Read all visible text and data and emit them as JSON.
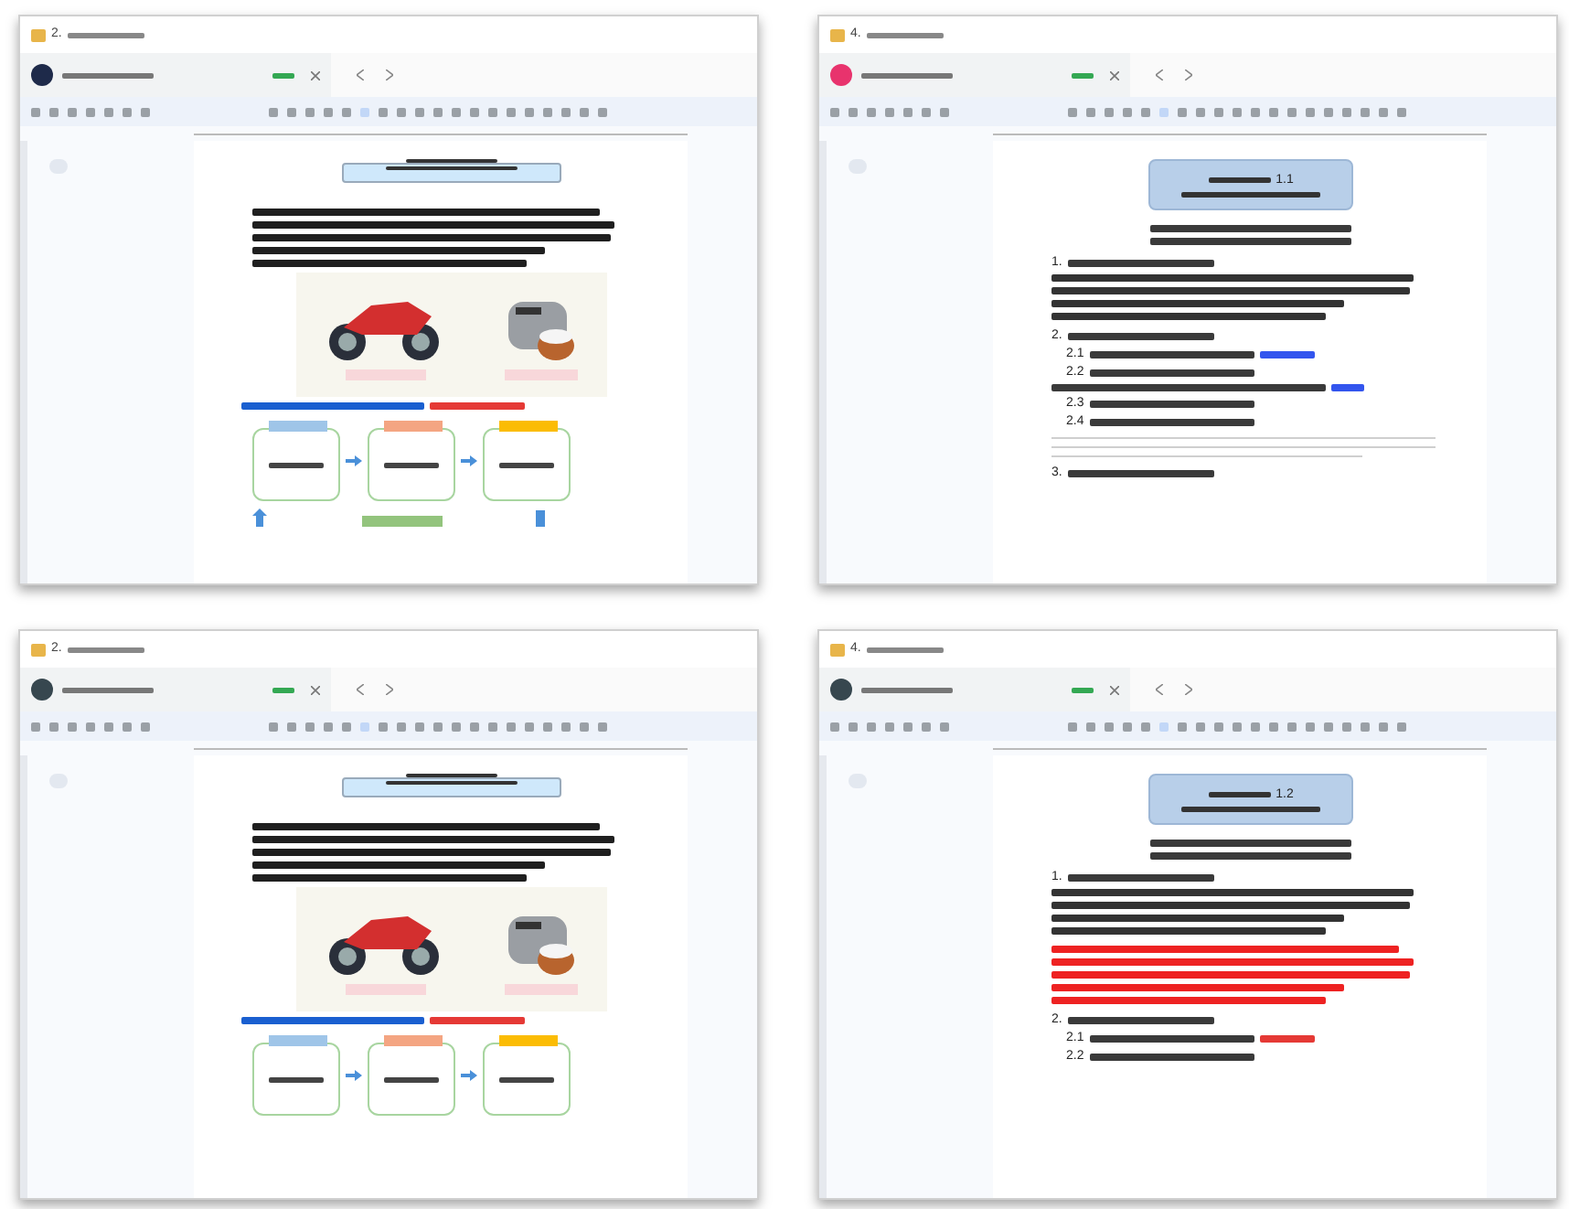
{
  "windows": [
    {
      "title_number": "2.",
      "avatar": {
        "color": "#1e2a4a"
      },
      "blocks": [
        {
          "kind": "title-box"
        },
        {
          "kind": "bold-lines"
        },
        {
          "kind": "photo"
        },
        {
          "kind": "blue-heading"
        },
        {
          "kind": "flow"
        },
        {
          "kind": "flow-bottom"
        }
      ]
    },
    {
      "title_number": "4.",
      "avatar": {
        "color": "#e8336d"
      },
      "blocks": [
        {
          "kind": "title-box",
          "number": "1.1"
        },
        {
          "kind": "centered-lines"
        },
        {
          "kind": "numbered",
          "number": "1."
        },
        {
          "kind": "lines"
        },
        {
          "kind": "numbered",
          "number": "2."
        },
        {
          "kind": "sub",
          "number": "2.1",
          "link": {
            "color": "#3355ee"
          }
        },
        {
          "kind": "sub",
          "number": "2.2"
        },
        {
          "kind": "plain-line",
          "link": {
            "color": "#3355ee"
          }
        },
        {
          "kind": "sub",
          "number": "2.3"
        },
        {
          "kind": "sub",
          "number": "2.4"
        },
        {
          "kind": "rules"
        },
        {
          "kind": "numbered",
          "number": "3."
        }
      ]
    },
    {
      "title_number": "2.",
      "avatar": {
        "color": "#37474f"
      },
      "blocks": [
        {
          "kind": "title-box"
        },
        {
          "kind": "bold-lines"
        },
        {
          "kind": "photo"
        },
        {
          "kind": "blue-heading"
        },
        {
          "kind": "flow"
        }
      ]
    },
    {
      "title_number": "4.",
      "avatar": {
        "color": "#37474f"
      },
      "blocks": [
        {
          "kind": "title-box",
          "number": "1.2"
        },
        {
          "kind": "centered-lines"
        },
        {
          "kind": "numbered",
          "number": "1."
        },
        {
          "kind": "lines"
        },
        {
          "kind": "red-lines"
        },
        {
          "kind": "numbered",
          "number": "2."
        },
        {
          "kind": "sub",
          "number": "2.1",
          "link": {
            "color": "#e53935"
          }
        },
        {
          "kind": "sub",
          "number": "2.2"
        }
      ]
    }
  ]
}
